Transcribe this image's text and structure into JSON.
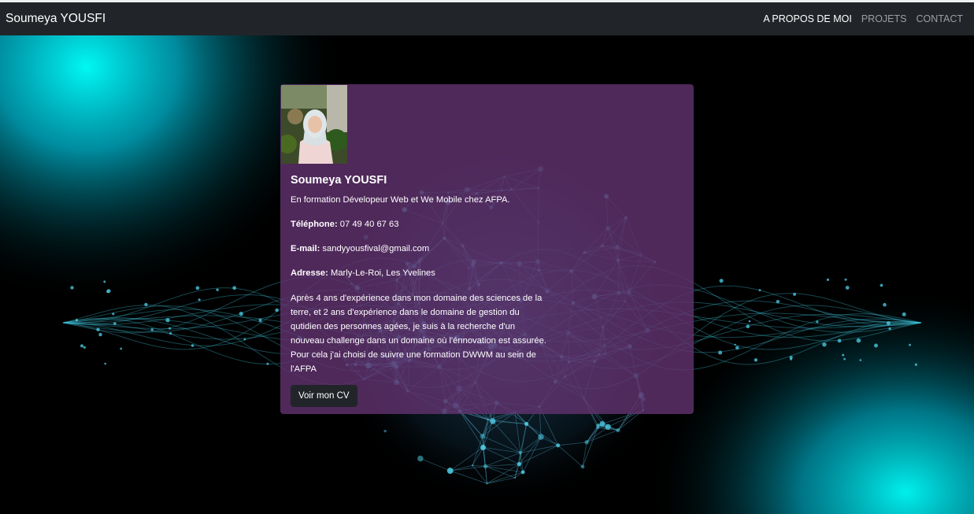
{
  "navbar": {
    "brand": "Soumeya YOUSFI",
    "links": [
      {
        "label": "A PROPOS DE MOI",
        "active": true
      },
      {
        "label": "PROJETS",
        "active": false
      },
      {
        "label": "CONTACT",
        "active": false
      }
    ]
  },
  "card": {
    "name": "Soumeya YOUSFI",
    "tagline": "En formation Dévelopeur Web et We Mobile chez AFPA.",
    "phone_label": "Téléphone:",
    "phone_value": "07 49 40 67 63",
    "email_label": "E-mail:",
    "email_value": "sandyyousfival@gmail.com",
    "address_label": "Adresse:",
    "address_value": "Marly-Le-Roi, Les Yvelines",
    "description": "Après 4 ans d'expérience dans mon domaine des sciences de la terre, et 2 ans d'expérience dans le domaine de gestion du qutidien des personnes agées, je suis à la recherche d'un nouveau challenge dans un domaine où l'énnovation est assurée. Pour cela j'ai choisi de suivre une formation DWWM au sein de l'AFPA",
    "cv_button": "Voir mon CV"
  },
  "colors": {
    "navbar_bg": "#212529",
    "card_bg": "#60326e",
    "accent_cyan": "#00f0f0",
    "button_bg": "#212529"
  }
}
